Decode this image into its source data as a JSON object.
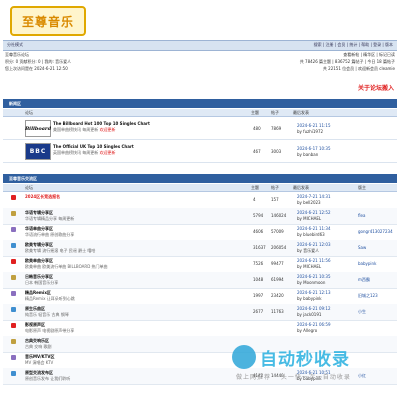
{
  "logo": {
    "text": "至尊音乐"
  },
  "nav": {
    "left": "分社模式",
    "right": "搜索 | 注册 | 会员 | 统计 | 帮助 | 登录 | 版本"
  },
  "info": {
    "forum_title": "至尊音乐论坛",
    "login_line": "积分: 0 贡献积分: 0 | 我的: 音乐爱人",
    "last_visit": "您上次访问是在 2024-6-21 12:50",
    "right1": "查看新帖 | 精华区 | 标记已读",
    "right2": "共 78426 篇主题 | 836752 篇帖子 | 今日 18 篇帖子",
    "right3": "共 22151 位会员 | 欢迎新会员 cleamie"
  },
  "join_text": "关于论坛搬入",
  "sections": [
    {
      "title": "新闻区"
    },
    {
      "title": "至尊音乐交流区"
    }
  ],
  "columns": {
    "forum": "论坛",
    "topics": "主题",
    "posts": "帖子",
    "last": "最后发表",
    "mod": "版主"
  },
  "news_forums": [
    {
      "logo": "Billboard",
      "name": "The Billboard Hot 100 Top 10 Singles Chart",
      "desc": "美国单曲榜快讯 每周更新",
      "tag": "欢迎更新",
      "topics": "480",
      "posts": "7869",
      "last_date": "2024-6-21 11:15",
      "last_by": "by fuzhi1972"
    },
    {
      "logo": "BBC",
      "name": "The Official UK Top 10 Singles Chart",
      "desc": "英国单曲榜快讯 每周更新",
      "tag": "欢迎更新",
      "topics": "467",
      "posts": "3003",
      "last_date": "2024-6-17 10:35",
      "last_by": "by banban"
    }
  ],
  "threads": [
    {
      "title": "2024区长竞选报名",
      "desc": "",
      "topics": "4",
      "posts": "157",
      "last_date": "2024-7-21 14:31",
      "last_by": "by bell2023",
      "mod": "",
      "red": true
    },
    {
      "title": "华语专辑分享区",
      "desc": "华语专辑精品分享 每周更新",
      "topics": "5794",
      "posts": "146024",
      "last_date": "2024-6-21 12:52",
      "last_by": "by MICHAEL",
      "mod": "flea",
      "red": false
    },
    {
      "title": "华语单曲分享区",
      "desc": "华语流行单曲 原创歌曲分享",
      "topics": "4606",
      "posts": "57009",
      "last_date": "2024-6-21 11:34",
      "last_by": "by bluebird63",
      "mod": "gongr413027234",
      "red": false
    },
    {
      "title": "欧美专辑分享区",
      "desc": "欧美专辑 流行摇滚 电子 民谣 爵士 嘻哈",
      "topics": "31637",
      "posts": "206054",
      "last_date": "2024-6-21 12:03",
      "last_by": "by 音乐爱人",
      "mod": "Saw",
      "red": false
    },
    {
      "title": "欧美单曲分享区",
      "desc": "欧美单曲 欧美流行单曲 BILLBOARD 热门单曲",
      "topics": "7526",
      "posts": "99477",
      "last_date": "2024-6-21 11:56",
      "last_by": "by MICHAEL",
      "mod": "babypink",
      "red": false
    },
    {
      "title": "日韩音乐分享区",
      "desc": "日本 韩国音乐分享",
      "topics": "1048",
      "posts": "61994",
      "last_date": "2024-6-21 10:35",
      "last_by": "by Moonmoon",
      "mod": "m西霸",
      "red": false
    },
    {
      "title": "精品Remix区",
      "desc": "精品Remix 让耳朵听到心跳",
      "topics": "1997",
      "posts": "23420",
      "last_date": "2024-6-21 12:13",
      "last_by": "by babypink",
      "mod": "旧城之123",
      "red": false
    },
    {
      "title": "原生乐曲区",
      "desc": "纯音乐 轻音乐 古典 钢琴",
      "topics": "2677",
      "posts": "11763",
      "last_date": "2024-6-21 09:12",
      "last_by": "by jack0191",
      "mod": "小生",
      "red": false
    },
    {
      "title": "影视原声区",
      "desc": "电影原声 电视剧原声带分享",
      "topics": "",
      "posts": "",
      "last_date": "2024-6-21 06:59",
      "last_by": "by Allegro",
      "mod": "",
      "red": false
    },
    {
      "title": "古典交响乐区",
      "desc": "古典 交响 歌剧",
      "topics": "",
      "posts": "",
      "last_date": "",
      "last_by": "",
      "mod": "",
      "red": false
    },
    {
      "title": "音乐MV/KTV区",
      "desc": "MV 演唱会 KTV",
      "topics": "",
      "posts": "",
      "last_date": "",
      "last_by": "",
      "mod": "",
      "red": false
    },
    {
      "title": "原型交流发布区",
      "desc": "原创音乐发布 让我们聆听",
      "topics": "4142",
      "posts": "14440",
      "last_date": "2024-6-21 10:51",
      "last_by": "by babypink",
      "mod": "小红",
      "red": false
    }
  ],
  "watermark": {
    "title": "自动秒收录",
    "sub": "做上网推荐 一头一快一次一自动收录"
  },
  "colors": {
    "header": "#2f5f9f",
    "nav": "#d7e3f1",
    "accent_red": "#e02020",
    "logo_gold": "#e0a800"
  }
}
